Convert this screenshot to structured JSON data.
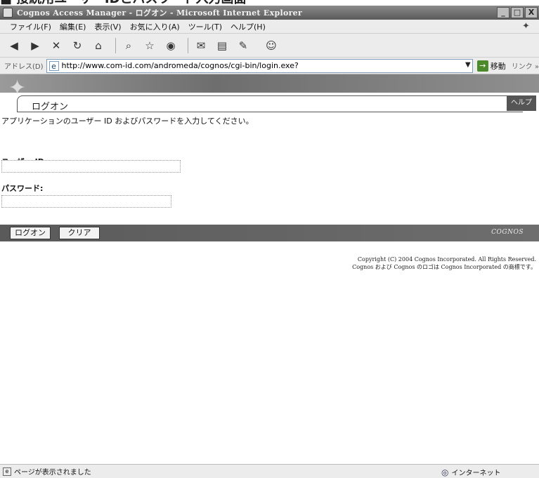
{
  "browser": {
    "window_title": "Cognos Access Manager - ログオン - Microsoft Internet Explorer",
    "menu": [
      "ファイル(F)",
      "編集(E)",
      "表示(V)",
      "お気に入り(A)",
      "ツール(T)",
      "ヘルプ(H)"
    ],
    "address_label": "アドレス(D)",
    "url": "http://www.com-id.com/andromeda/cognos/cgi-bin/login.exe?",
    "go_label": "移動",
    "links_label": "リンク »",
    "status_text": "ページが表示されました",
    "zone_text": "インターネット",
    "window_buttons": [
      "_",
      "□",
      "X"
    ]
  },
  "caption": "■ 接続用ユーザーIDとパスワード入力画面",
  "page": {
    "title": "ログオン",
    "help": "ヘルプ",
    "instructions": "アプリケーションのユーザー ID およびパスワードを入力してください。",
    "user_id_label": "ユーザー ID:",
    "user_id_value": "",
    "password_label": "パスワード:",
    "password_value": "",
    "logon_button": "ログオン",
    "clear_button": "クリア",
    "brand": "COGNOS",
    "copyright_line1": "Copyright (C) 2004 Cognos Incorporated. All Rights Reserved.",
    "copyright_line2": "Cognos および Cognos のロゴは Cognos Incorporated の商標です。"
  },
  "icons": {
    "back": "◀",
    "forward": "▶",
    "stop": "✕",
    "refresh": "↻",
    "home": "⌂",
    "search": "⌕",
    "favorites": "☆",
    "media": "◉",
    "history": "◷",
    "mail": "✉",
    "print": "▤",
    "edit": "✎",
    "messenger": "☺",
    "page": "e",
    "go": "→",
    "globe": "◎",
    "throbber": "✦"
  },
  "colors": {
    "titlebar": "#6a6a6a",
    "banner": "#7a7a7a",
    "action_bar": "#606060"
  }
}
